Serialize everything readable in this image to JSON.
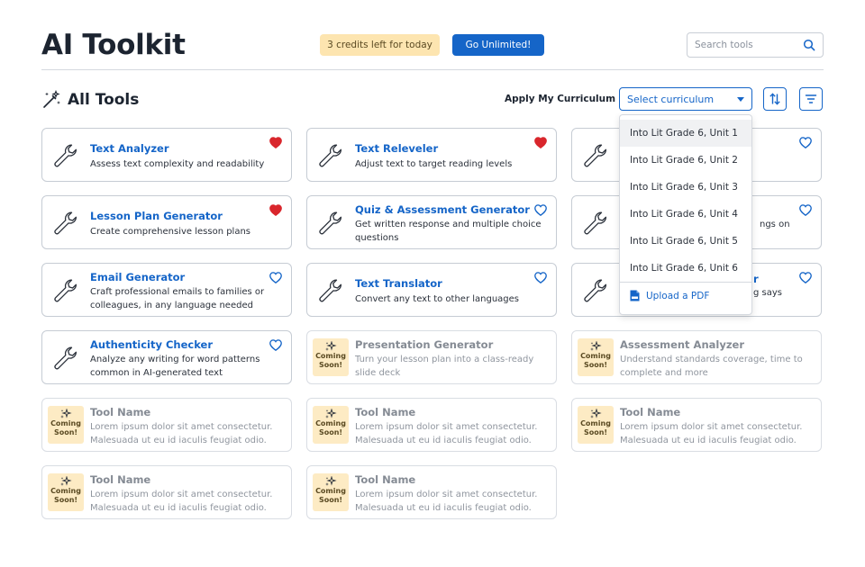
{
  "header": {
    "title": "AI Toolkit",
    "credits": "3 credits left for today",
    "upgrade_label": "Go Unlimited!",
    "search_placeholder": "Search tools"
  },
  "toolbar": {
    "section_title": "All Tools",
    "curriculum_label": "Apply My Curriculum",
    "curriculum_value": "Select curriculum"
  },
  "curriculum_options": [
    "Into Lit Grade 6, Unit 1",
    "Into Lit Grade 6, Unit 2",
    "Into Lit Grade 6, Unit 3",
    "Into Lit Grade 6, Unit 4",
    "Into Lit Grade 6, Unit 5",
    "Into Lit Grade 6, Unit 6"
  ],
  "upload_label": "Upload a PDF",
  "coming_soon": [
    "Coming",
    "Soon!"
  ],
  "tools": [
    {
      "title": "Text Analyzer",
      "desc": "Assess text complexity and readability",
      "favorite": true
    },
    {
      "title": "Text Releveler",
      "desc": "Adjust text to target reading levels",
      "favorite": true
    },
    {
      "title": "",
      "desc": "",
      "favorite": false
    },
    {
      "title": "Lesson Plan Generator",
      "desc": "Create comprehensive lesson plans",
      "favorite": true
    },
    {
      "title": "Quiz & Assessment Generator",
      "desc": "Get written response and multiple choice questions",
      "favorite": false
    },
    {
      "title": "",
      "desc": "ngs on",
      "favorite": false
    },
    {
      "title": "Email Generator",
      "desc": "Craft professional emails to families or colleagues, in any language needed",
      "favorite": false
    },
    {
      "title": "Text Translator",
      "desc": "Convert any text to other languages",
      "favorite": false
    },
    {
      "title": "r",
      "desc": "g says",
      "favorite": false
    },
    {
      "title": "Authenticity Checker",
      "desc": "Analyze any writing for word patterns common in AI-generated text",
      "favorite": false
    }
  ],
  "upcoming": [
    {
      "title": "Presentation Generator",
      "desc": "Turn your lesson plan into a class-ready slide deck"
    },
    {
      "title": "Assessment Analyzer",
      "desc": "Understand standards coverage, time to complete and more"
    },
    {
      "title": "Tool Name",
      "desc": "Lorem ipsum dolor sit amet consectetur. Malesuada ut eu id iaculis feugiat odio."
    },
    {
      "title": "Tool Name",
      "desc": "Lorem ipsum dolor sit amet consectetur. Malesuada ut eu id iaculis feugiat odio."
    },
    {
      "title": "Tool Name",
      "desc": "Lorem ipsum dolor sit amet consectetur. Malesuada ut eu id iaculis feugiat odio."
    },
    {
      "title": "Tool Name",
      "desc": "Lorem ipsum dolor sit amet consectetur. Malesuada ut eu id iaculis feugiat odio."
    },
    {
      "title": "Tool Name",
      "desc": "Lorem ipsum dolor sit amet consectetur. Malesuada ut eu id iaculis feugiat odio."
    }
  ],
  "colors": {
    "accent": "#1565c8",
    "favorite": "#d9262c",
    "credits_bg": "#fde5b0",
    "coming_soon_bg": "#fdebc4"
  },
  "icons": {
    "search": "search-icon",
    "wand": "magic-wand-icon",
    "sort": "sort-arrows-icon",
    "filter": "filter-icon",
    "tool": "wrench-icon",
    "favorite": "heart-icon",
    "coming_soon": "sparkle-icon",
    "upload": "pdf-file-icon"
  }
}
